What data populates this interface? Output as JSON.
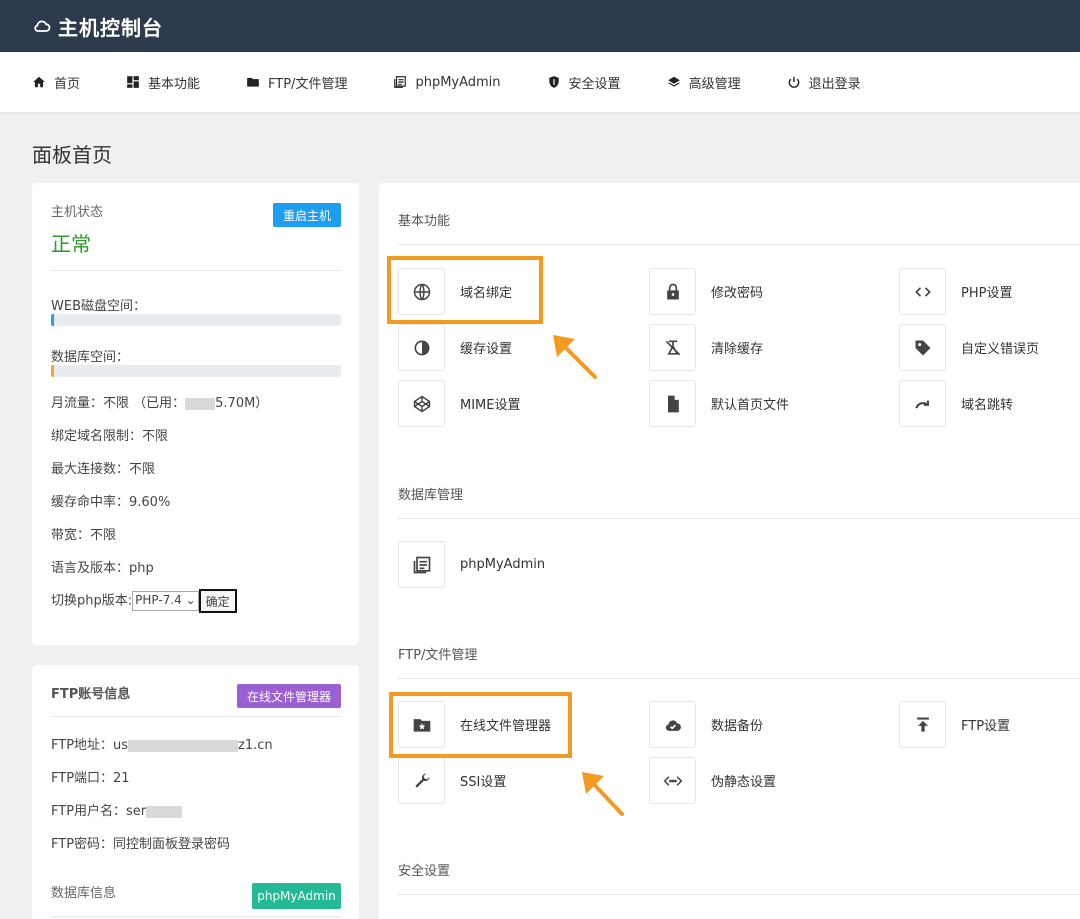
{
  "app": {
    "title": "主机控制台",
    "logo_icon": "cloud-icon"
  },
  "nav": [
    {
      "label": "首页",
      "icon": "home-icon"
    },
    {
      "label": "基本功能",
      "icon": "grid-icon"
    },
    {
      "label": "FTP/文件管理",
      "icon": "folder-icon"
    },
    {
      "label": "phpMyAdmin",
      "icon": "database-doc-icon"
    },
    {
      "label": "安全设置",
      "icon": "shield-icon"
    },
    {
      "label": "高级管理",
      "icon": "layers-icon"
    },
    {
      "label": "退出登录",
      "icon": "power-icon"
    }
  ],
  "page_title": "面板首页",
  "host_status": {
    "label": "主机状态",
    "value": "正常",
    "restart_button": "重启主机",
    "web_disk_label": "WEB磁盘空间：",
    "web_disk_usage": 0.01,
    "db_space_label": "数据库空间：",
    "db_space_usage": 0.01,
    "monthly_traffic_prefix": "月流量：不限 （已用：",
    "monthly_traffic_used": "5.70M）",
    "domain_limit": "绑定域名限制：不限",
    "max_connections": "最大连接数：不限",
    "cache_hit": "缓存命中率：9.60%",
    "bandwidth": "带宽：不限",
    "language": "语言及版本：php",
    "php_switch_label": "切换php版本:",
    "php_version": "PHP-7.4",
    "confirm_button": "确定"
  },
  "ftp_info": {
    "label": "FTP账号信息",
    "file_manager_button": "在线文件管理器",
    "address_prefix": "FTP地址：us",
    "address_suffix": "z1.cn",
    "port": "FTP端口：21",
    "username_prefix": "FTP用户名：ser",
    "password": "FTP密码：同控制面板登录密码",
    "db_label": "数据库信息",
    "pma_button": "phpMyAdmin"
  },
  "sections": {
    "basic": {
      "title": "基本功能",
      "tiles": [
        {
          "label": "域名绑定",
          "icon": "globe-icon"
        },
        {
          "label": "修改密码",
          "icon": "lock-icon"
        },
        {
          "label": "PHP设置",
          "icon": "code-icon"
        },
        {
          "label": "缓存设置",
          "icon": "contrast-icon"
        },
        {
          "label": "清除缓存",
          "icon": "eraser-icon"
        },
        {
          "label": "自定义错误页",
          "icon": "tag-icon"
        },
        {
          "label": "MIME设置",
          "icon": "codepen-icon"
        },
        {
          "label": "默认首页文件",
          "icon": "file-icon"
        },
        {
          "label": "域名跳转",
          "icon": "redirect-icon"
        }
      ]
    },
    "database": {
      "title": "数据库管理",
      "tiles": [
        {
          "label": "phpMyAdmin",
          "icon": "database-doc-icon"
        }
      ]
    },
    "ftp": {
      "title": "FTP/文件管理",
      "tiles": [
        {
          "label": "在线文件管理器",
          "icon": "folder-star-icon"
        },
        {
          "label": "数据备份",
          "icon": "cloud-check-icon"
        },
        {
          "label": "FTP设置",
          "icon": "upload-icon"
        },
        {
          "label": "SSI设置",
          "icon": "wrench-icon"
        },
        {
          "label": "伪静态设置",
          "icon": "code-dots-icon"
        }
      ]
    },
    "security": {
      "title": "安全设置"
    }
  },
  "colors": {
    "topbar": "#2c3a4b",
    "status_ok": "#2e9a2e",
    "restart": "#1d9ef1",
    "file_manager": "#9a5fd3",
    "phpmyadmin": "#25b996",
    "highlight": "#f39a22",
    "web_disk_fill": "#29a3e0",
    "db_space_fill": "#f0a830"
  }
}
